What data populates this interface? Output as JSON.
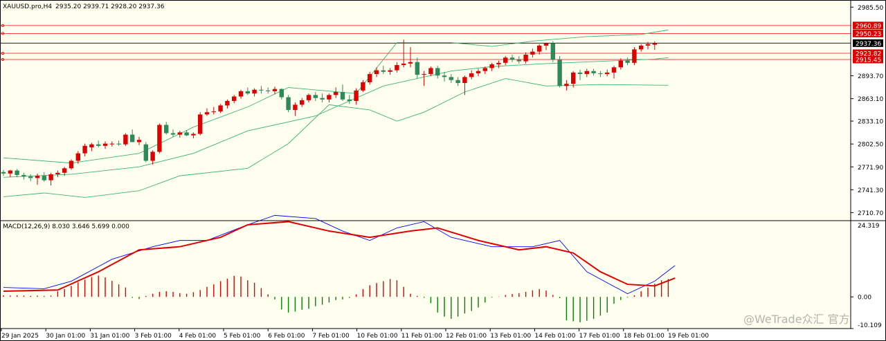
{
  "header": {
    "symbol": "XAUUSD.pro,H4",
    "ohlc": "2935.20 2939.71 2928.20 2937.36"
  },
  "indicator": {
    "label": "MACD(12,26,9) 8.030 3.646 5.699 0.000"
  },
  "watermark": "@WeTrade众汇 官方",
  "colors": {
    "background": "#fffff0",
    "bull_candle": "#dd0000",
    "bear_candle": "#2e8b57",
    "bollinger": "#3cb371",
    "hline": "#ff0000",
    "price_line": "#000000",
    "macd_line": "#0000ff",
    "signal_line": "#dd0000",
    "hist_pos": "#dd0000",
    "hist_neg": "#008000"
  },
  "chart_data": [
    {
      "type": "candlestick",
      "title": "XAUUSD.pro,H4",
      "ylim": [
        2700,
        2995
      ],
      "y_ticks": [
        "2985.50",
        "2893.70",
        "2863.10",
        "2833.10",
        "2802.50",
        "2771.90",
        "2741.30",
        "2710.70"
      ],
      "price_labels": [
        {
          "label": "2960.89",
          "value": 2960.89,
          "kind": "hline"
        },
        {
          "label": "2950.23",
          "value": 2950.23,
          "kind": "hline"
        },
        {
          "label": "2937.36",
          "value": 2937.36,
          "kind": "current"
        },
        {
          "label": "2923.82",
          "value": 2923.82,
          "kind": "hline"
        },
        {
          "label": "2915.45",
          "value": 2915.45,
          "kind": "hline"
        }
      ],
      "x_labels": [
        "29 Jan 2025",
        "30 Jan 01:00",
        "31 Jan 01:00",
        "3 Feb 01:00",
        "4 Feb 01:00",
        "5 Feb 01:00",
        "6 Feb 01:00",
        "7 Feb 01:00",
        "10 Feb 01:00",
        "11 Feb 01:00",
        "12 Feb 01:00",
        "13 Feb 01:00",
        "14 Feb 01:00",
        "17 Feb 01:00",
        "18 Feb 01:00",
        "19 Feb 01:00"
      ],
      "candles": [
        {
          "o": 2765,
          "h": 2768,
          "l": 2760,
          "c": 2763
        },
        {
          "o": 2763,
          "h": 2768,
          "l": 2758,
          "c": 2767
        },
        {
          "o": 2767,
          "h": 2769,
          "l": 2758,
          "c": 2761
        },
        {
          "o": 2761,
          "h": 2764,
          "l": 2755,
          "c": 2759
        },
        {
          "o": 2759,
          "h": 2762,
          "l": 2753,
          "c": 2757
        },
        {
          "o": 2757,
          "h": 2763,
          "l": 2748,
          "c": 2760
        },
        {
          "o": 2760,
          "h": 2765,
          "l": 2752,
          "c": 2754
        },
        {
          "o": 2754,
          "h": 2764,
          "l": 2747,
          "c": 2762
        },
        {
          "o": 2762,
          "h": 2767,
          "l": 2758,
          "c": 2764
        },
        {
          "o": 2764,
          "h": 2772,
          "l": 2760,
          "c": 2770
        },
        {
          "o": 2770,
          "h": 2782,
          "l": 2768,
          "c": 2780
        },
        {
          "o": 2780,
          "h": 2793,
          "l": 2776,
          "c": 2790
        },
        {
          "o": 2790,
          "h": 2803,
          "l": 2786,
          "c": 2800
        },
        {
          "o": 2798,
          "h": 2804,
          "l": 2793,
          "c": 2802
        },
        {
          "o": 2802,
          "h": 2807,
          "l": 2798,
          "c": 2800
        },
        {
          "o": 2800,
          "h": 2806,
          "l": 2796,
          "c": 2803
        },
        {
          "o": 2802,
          "h": 2806,
          "l": 2799,
          "c": 2803
        },
        {
          "o": 2803,
          "h": 2807,
          "l": 2800,
          "c": 2802
        },
        {
          "o": 2802,
          "h": 2817,
          "l": 2800,
          "c": 2815
        },
        {
          "o": 2815,
          "h": 2822,
          "l": 2810,
          "c": 2805
        },
        {
          "o": 2805,
          "h": 2812,
          "l": 2801,
          "c": 2808
        },
        {
          "o": 2802,
          "h": 2805,
          "l": 2778,
          "c": 2780
        },
        {
          "o": 2780,
          "h": 2794,
          "l": 2775,
          "c": 2792
        },
        {
          "o": 2792,
          "h": 2830,
          "l": 2790,
          "c": 2828
        },
        {
          "o": 2828,
          "h": 2832,
          "l": 2815,
          "c": 2817
        },
        {
          "o": 2817,
          "h": 2822,
          "l": 2812,
          "c": 2815
        },
        {
          "o": 2815,
          "h": 2820,
          "l": 2811,
          "c": 2818
        },
        {
          "o": 2818,
          "h": 2821,
          "l": 2813,
          "c": 2814
        },
        {
          "o": 2814,
          "h": 2818,
          "l": 2810,
          "c": 2816
        },
        {
          "o": 2816,
          "h": 2845,
          "l": 2814,
          "c": 2842
        },
        {
          "o": 2842,
          "h": 2850,
          "l": 2840,
          "c": 2845
        },
        {
          "o": 2845,
          "h": 2852,
          "l": 2842,
          "c": 2846
        },
        {
          "o": 2846,
          "h": 2856,
          "l": 2844,
          "c": 2854
        },
        {
          "o": 2854,
          "h": 2862,
          "l": 2850,
          "c": 2860
        },
        {
          "o": 2860,
          "h": 2868,
          "l": 2857,
          "c": 2866
        },
        {
          "o": 2866,
          "h": 2875,
          "l": 2863,
          "c": 2873
        },
        {
          "o": 2873,
          "h": 2878,
          "l": 2868,
          "c": 2870
        },
        {
          "o": 2870,
          "h": 2877,
          "l": 2866,
          "c": 2875
        },
        {
          "o": 2875,
          "h": 2880,
          "l": 2870,
          "c": 2874
        },
        {
          "o": 2874,
          "h": 2878,
          "l": 2870,
          "c": 2873
        },
        {
          "o": 2873,
          "h": 2879,
          "l": 2869,
          "c": 2876
        },
        {
          "o": 2876,
          "h": 2877,
          "l": 2862,
          "c": 2865
        },
        {
          "o": 2865,
          "h": 2868,
          "l": 2845,
          "c": 2848
        },
        {
          "o": 2848,
          "h": 2858,
          "l": 2840,
          "c": 2855
        },
        {
          "o": 2855,
          "h": 2864,
          "l": 2852,
          "c": 2861
        },
        {
          "o": 2861,
          "h": 2870,
          "l": 2858,
          "c": 2868
        },
        {
          "o": 2868,
          "h": 2872,
          "l": 2860,
          "c": 2864
        },
        {
          "o": 2864,
          "h": 2870,
          "l": 2858,
          "c": 2862
        },
        {
          "o": 2862,
          "h": 2870,
          "l": 2858,
          "c": 2868
        },
        {
          "o": 2868,
          "h": 2878,
          "l": 2864,
          "c": 2872
        },
        {
          "o": 2872,
          "h": 2882,
          "l": 2860,
          "c": 2862
        },
        {
          "o": 2862,
          "h": 2868,
          "l": 2856,
          "c": 2860
        },
        {
          "o": 2860,
          "h": 2877,
          "l": 2855,
          "c": 2874
        },
        {
          "o": 2874,
          "h": 2888,
          "l": 2872,
          "c": 2885
        },
        {
          "o": 2885,
          "h": 2899,
          "l": 2882,
          "c": 2896
        },
        {
          "o": 2896,
          "h": 2905,
          "l": 2892,
          "c": 2901
        },
        {
          "o": 2901,
          "h": 2907,
          "l": 2896,
          "c": 2899
        },
        {
          "o": 2899,
          "h": 2904,
          "l": 2895,
          "c": 2901
        },
        {
          "o": 2901,
          "h": 2912,
          "l": 2898,
          "c": 2908
        },
        {
          "o": 2908,
          "h": 2942,
          "l": 2905,
          "c": 2910
        },
        {
          "o": 2910,
          "h": 2932,
          "l": 2905,
          "c": 2912
        },
        {
          "o": 2912,
          "h": 2918,
          "l": 2890,
          "c": 2895
        },
        {
          "o": 2895,
          "h": 2900,
          "l": 2880,
          "c": 2896
        },
        {
          "o": 2896,
          "h": 2906,
          "l": 2893,
          "c": 2904
        },
        {
          "o": 2904,
          "h": 2907,
          "l": 2890,
          "c": 2894
        },
        {
          "o": 2894,
          "h": 2899,
          "l": 2886,
          "c": 2892
        },
        {
          "o": 2892,
          "h": 2896,
          "l": 2884,
          "c": 2888
        },
        {
          "o": 2888,
          "h": 2892,
          "l": 2880,
          "c": 2884
        },
        {
          "o": 2884,
          "h": 2894,
          "l": 2868,
          "c": 2892
        },
        {
          "o": 2892,
          "h": 2901,
          "l": 2889,
          "c": 2897
        },
        {
          "o": 2897,
          "h": 2903,
          "l": 2893,
          "c": 2900
        },
        {
          "o": 2900,
          "h": 2906,
          "l": 2896,
          "c": 2904
        },
        {
          "o": 2904,
          "h": 2911,
          "l": 2900,
          "c": 2909
        },
        {
          "o": 2909,
          "h": 2914,
          "l": 2904,
          "c": 2911
        },
        {
          "o": 2911,
          "h": 2920,
          "l": 2908,
          "c": 2918
        },
        {
          "o": 2918,
          "h": 2922,
          "l": 2912,
          "c": 2915
        },
        {
          "o": 2915,
          "h": 2920,
          "l": 2910,
          "c": 2913
        },
        {
          "o": 2913,
          "h": 2925,
          "l": 2910,
          "c": 2922
        },
        {
          "o": 2922,
          "h": 2930,
          "l": 2918,
          "c": 2926
        },
        {
          "o": 2926,
          "h": 2936,
          "l": 2922,
          "c": 2934
        },
        {
          "o": 2934,
          "h": 2938,
          "l": 2928,
          "c": 2937
        },
        {
          "o": 2937,
          "h": 2940,
          "l": 2912,
          "c": 2915
        },
        {
          "o": 2915,
          "h": 2920,
          "l": 2878,
          "c": 2880
        },
        {
          "o": 2880,
          "h": 2888,
          "l": 2874,
          "c": 2883
        },
        {
          "o": 2883,
          "h": 2900,
          "l": 2878,
          "c": 2898
        },
        {
          "o": 2898,
          "h": 2902,
          "l": 2888,
          "c": 2896
        },
        {
          "o": 2896,
          "h": 2903,
          "l": 2892,
          "c": 2900
        },
        {
          "o": 2900,
          "h": 2903,
          "l": 2894,
          "c": 2897
        },
        {
          "o": 2897,
          "h": 2900,
          "l": 2892,
          "c": 2896
        },
        {
          "o": 2896,
          "h": 2902,
          "l": 2893,
          "c": 2898
        },
        {
          "o": 2898,
          "h": 2907,
          "l": 2890,
          "c": 2905
        },
        {
          "o": 2905,
          "h": 2917,
          "l": 2902,
          "c": 2914
        },
        {
          "o": 2914,
          "h": 2918,
          "l": 2908,
          "c": 2911
        },
        {
          "o": 2911,
          "h": 2932,
          "l": 2908,
          "c": 2929
        },
        {
          "o": 2929,
          "h": 2936,
          "l": 2926,
          "c": 2934
        },
        {
          "o": 2934,
          "h": 2939,
          "l": 2929,
          "c": 2936
        },
        {
          "o": 2935.2,
          "h": 2939.71,
          "l": 2928.2,
          "c": 2937.36
        }
      ],
      "bollinger": {
        "upper": [
          [
            0,
            2784
          ],
          [
            10,
            2777
          ],
          [
            20,
            2790
          ],
          [
            28,
            2825
          ],
          [
            36,
            2852
          ],
          [
            42,
            2878
          ],
          [
            52,
            2870
          ],
          [
            58,
            2938
          ],
          [
            66,
            2938
          ],
          [
            72,
            2933
          ],
          [
            78,
            2940
          ],
          [
            86,
            2946
          ],
          [
            94,
            2949
          ],
          [
            98,
            2955
          ]
        ],
        "middle": [
          [
            0,
            2758
          ],
          [
            10,
            2762
          ],
          [
            20,
            2772
          ],
          [
            28,
            2790
          ],
          [
            36,
            2820
          ],
          [
            46,
            2840
          ],
          [
            56,
            2880
          ],
          [
            66,
            2900
          ],
          [
            72,
            2906
          ],
          [
            80,
            2910
          ],
          [
            88,
            2913
          ],
          [
            96,
            2916
          ],
          [
            98,
            2918
          ]
        ],
        "lower": [
          [
            0,
            2732
          ],
          [
            6,
            2737
          ],
          [
            12,
            2731
          ],
          [
            20,
            2740
          ],
          [
            26,
            2760
          ],
          [
            36,
            2770
          ],
          [
            42,
            2803
          ],
          [
            48,
            2855
          ],
          [
            54,
            2848
          ],
          [
            58,
            2833
          ],
          [
            62,
            2845
          ],
          [
            68,
            2872
          ],
          [
            74,
            2890
          ],
          [
            80,
            2880
          ],
          [
            88,
            2882
          ],
          [
            98,
            2881
          ]
        ]
      }
    },
    {
      "type": "macd",
      "title": "MACD(12,26,9) 8.030 3.646 5.699 0.000",
      "ylim": [
        -10.109,
        24.319
      ],
      "y_ticks": [
        "24.319",
        "0.00",
        "-10.109"
      ],
      "macd_line": [
        [
          0,
          3
        ],
        [
          6,
          2.6
        ],
        [
          10,
          5
        ],
        [
          16,
          12
        ],
        [
          22,
          16
        ],
        [
          26,
          18
        ],
        [
          30,
          18
        ],
        [
          36,
          23
        ],
        [
          40,
          26
        ],
        [
          46,
          25
        ],
        [
          50,
          21
        ],
        [
          54,
          18
        ],
        [
          58,
          22
        ],
        [
          62,
          24
        ],
        [
          66,
          19
        ],
        [
          72,
          16
        ],
        [
          78,
          16
        ],
        [
          82,
          18
        ],
        [
          86,
          8
        ],
        [
          92,
          1
        ],
        [
          96,
          5
        ],
        [
          99,
          10
        ]
      ],
      "signal_line": [
        [
          0,
          1.8
        ],
        [
          8,
          2.2
        ],
        [
          14,
          8
        ],
        [
          20,
          15
        ],
        [
          26,
          16
        ],
        [
          32,
          19
        ],
        [
          36,
          23
        ],
        [
          42,
          24
        ],
        [
          48,
          21
        ],
        [
          54,
          19
        ],
        [
          60,
          21
        ],
        [
          64,
          22
        ],
        [
          70,
          18
        ],
        [
          76,
          15
        ],
        [
          80,
          16
        ],
        [
          84,
          14
        ],
        [
          88,
          8
        ],
        [
          92,
          4
        ],
        [
          96,
          3.5
        ],
        [
          99,
          6
        ]
      ],
      "histogram": [
        0.5,
        0.4,
        0.5,
        0.4,
        0.3,
        0.4,
        0.3,
        0.4,
        1.8,
        2.5,
        3.5,
        4.6,
        5.5,
        6.3,
        6.8,
        6.2,
        5.1,
        4.0,
        3.0,
        -0.3,
        -0.7,
        0.3,
        1.0,
        1.6,
        1.8,
        1.6,
        1.2,
        1.0,
        1.5,
        2.2,
        3.2,
        4.0,
        5.0,
        5.8,
        6.7,
        6.5,
        5.3,
        4.5,
        2.8,
        0.8,
        -0.8,
        -4.0,
        -5.0,
        -4.7,
        -4.1,
        -3.8,
        -3.0,
        -2.5,
        -1.8,
        -1.0,
        -0.8,
        -0.3,
        0.8,
        2.5,
        3.7,
        4.4,
        5.0,
        5.7,
        5.3,
        3.2,
        1.0,
        0.3,
        -0.3,
        -2.0,
        -5.0,
        -6.3,
        -7.0,
        -6.3,
        -5.3,
        -4.5,
        -3.4,
        -1.8,
        -0.2,
        0.1,
        0.6,
        0.9,
        1.2,
        1.6,
        2.1,
        2.5,
        2.0,
        0.6,
        -0.4,
        -7.5,
        -7.8,
        -8.1,
        -7.6,
        -7.0,
        -6.0,
        -5.0,
        -2.2,
        -1.0,
        -0.2,
        0.5,
        1.8,
        3.0,
        4.2,
        5.3,
        5.7
      ]
    }
  ]
}
